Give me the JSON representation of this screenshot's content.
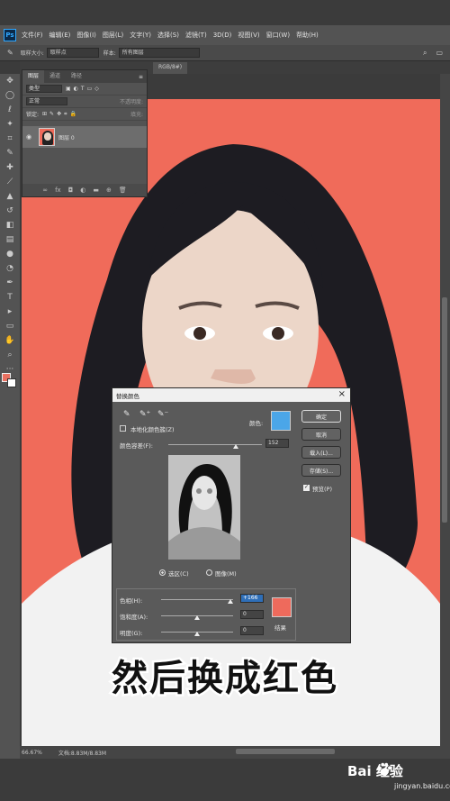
{
  "app": {
    "logo": "Ps",
    "menu": [
      "文件(F)",
      "编辑(E)",
      "图像(I)",
      "图层(L)",
      "文字(Y)",
      "选择(S)",
      "滤镜(T)",
      "3D(D)",
      "视图(V)",
      "窗口(W)",
      "帮助(H)"
    ]
  },
  "options_bar": {
    "sample_size_label": "取样大小:",
    "sample_size_value": "取样点",
    "sample_label": "样本:",
    "sample_value": "所有图层"
  },
  "document": {
    "tab_fragment": "RGB/8#)",
    "zoom": "66.67%",
    "doc_info": "文档:8.83M/8.83M"
  },
  "layers_panel": {
    "tabs": [
      "图层",
      "通道",
      "路径"
    ],
    "kind_label": "类型",
    "blend_mode": "正常",
    "opacity_label": "不透明度:",
    "lock_label": "锁定:",
    "fill_label": "填充:",
    "layer_name": "图层 0"
  },
  "dialog": {
    "title": "替换颜色",
    "localized_label": "本地化颜色簇(Z)",
    "color_label": "颜色:",
    "fuzziness_label": "颜色容差(F):",
    "fuzziness_value": "152",
    "selection_label": "选区(C)",
    "image_label": "图像(M)",
    "hue_label": "色相(H):",
    "hue_value": "+166",
    "saturation_label": "饱和度(A):",
    "saturation_value": "0",
    "lightness_label": "明度(G):",
    "lightness_value": "0",
    "result_label": "结果",
    "buttons": {
      "ok": "确定",
      "cancel": "取消",
      "load": "载入(L)...",
      "save": "存储(S)...",
      "preview": "预览(P)"
    },
    "selected_color": "#4ba6e8",
    "result_color": "#ee6a5c"
  },
  "caption": "然后换成红色",
  "watermark": {
    "main": "Bai 经验",
    "sub": "jingyan.baidu.com"
  }
}
